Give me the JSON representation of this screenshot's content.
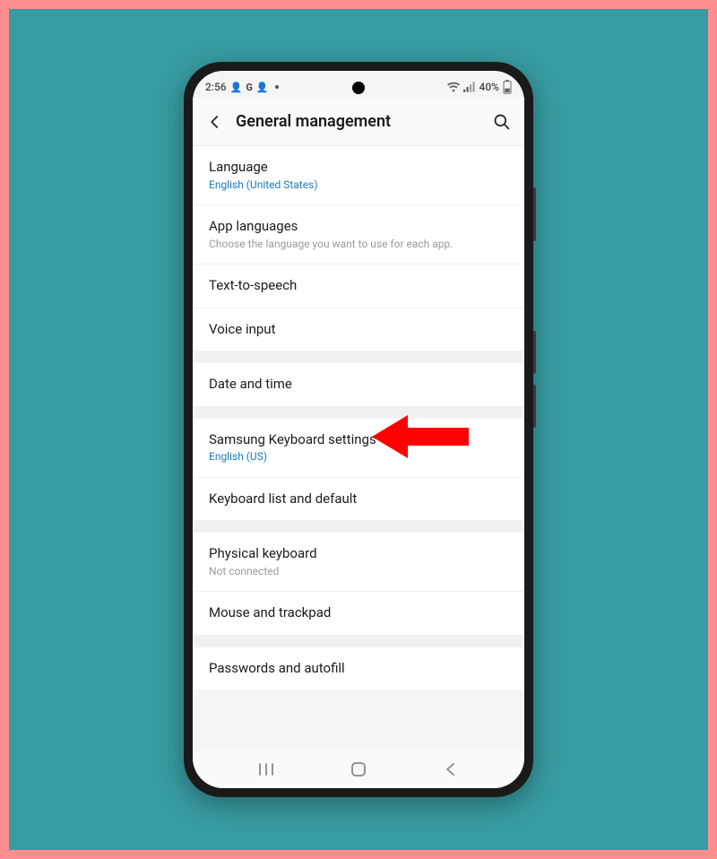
{
  "status_bar": {
    "time": "2:56",
    "battery_pct": "40%"
  },
  "header": {
    "title": "General management"
  },
  "groups": [
    {
      "items": [
        {
          "title": "Language",
          "sub": "English (United States)",
          "sub_style": "link"
        },
        {
          "title": "App languages",
          "sub": "Choose the language you want to use for each app."
        },
        {
          "title": "Text-to-speech"
        },
        {
          "title": "Voice input"
        }
      ]
    },
    {
      "items": [
        {
          "title": "Date and time"
        }
      ]
    },
    {
      "items": [
        {
          "title": "Samsung Keyboard settings",
          "sub": "English (US)",
          "sub_style": "link"
        },
        {
          "title": "Keyboard list and default"
        }
      ]
    },
    {
      "items": [
        {
          "title": "Physical keyboard",
          "sub": "Not connected"
        },
        {
          "title": "Mouse and trackpad"
        }
      ]
    },
    {
      "items": [
        {
          "title": "Passwords and autofill"
        }
      ]
    }
  ],
  "annotation": {
    "arrow_color": "#ff0000"
  }
}
